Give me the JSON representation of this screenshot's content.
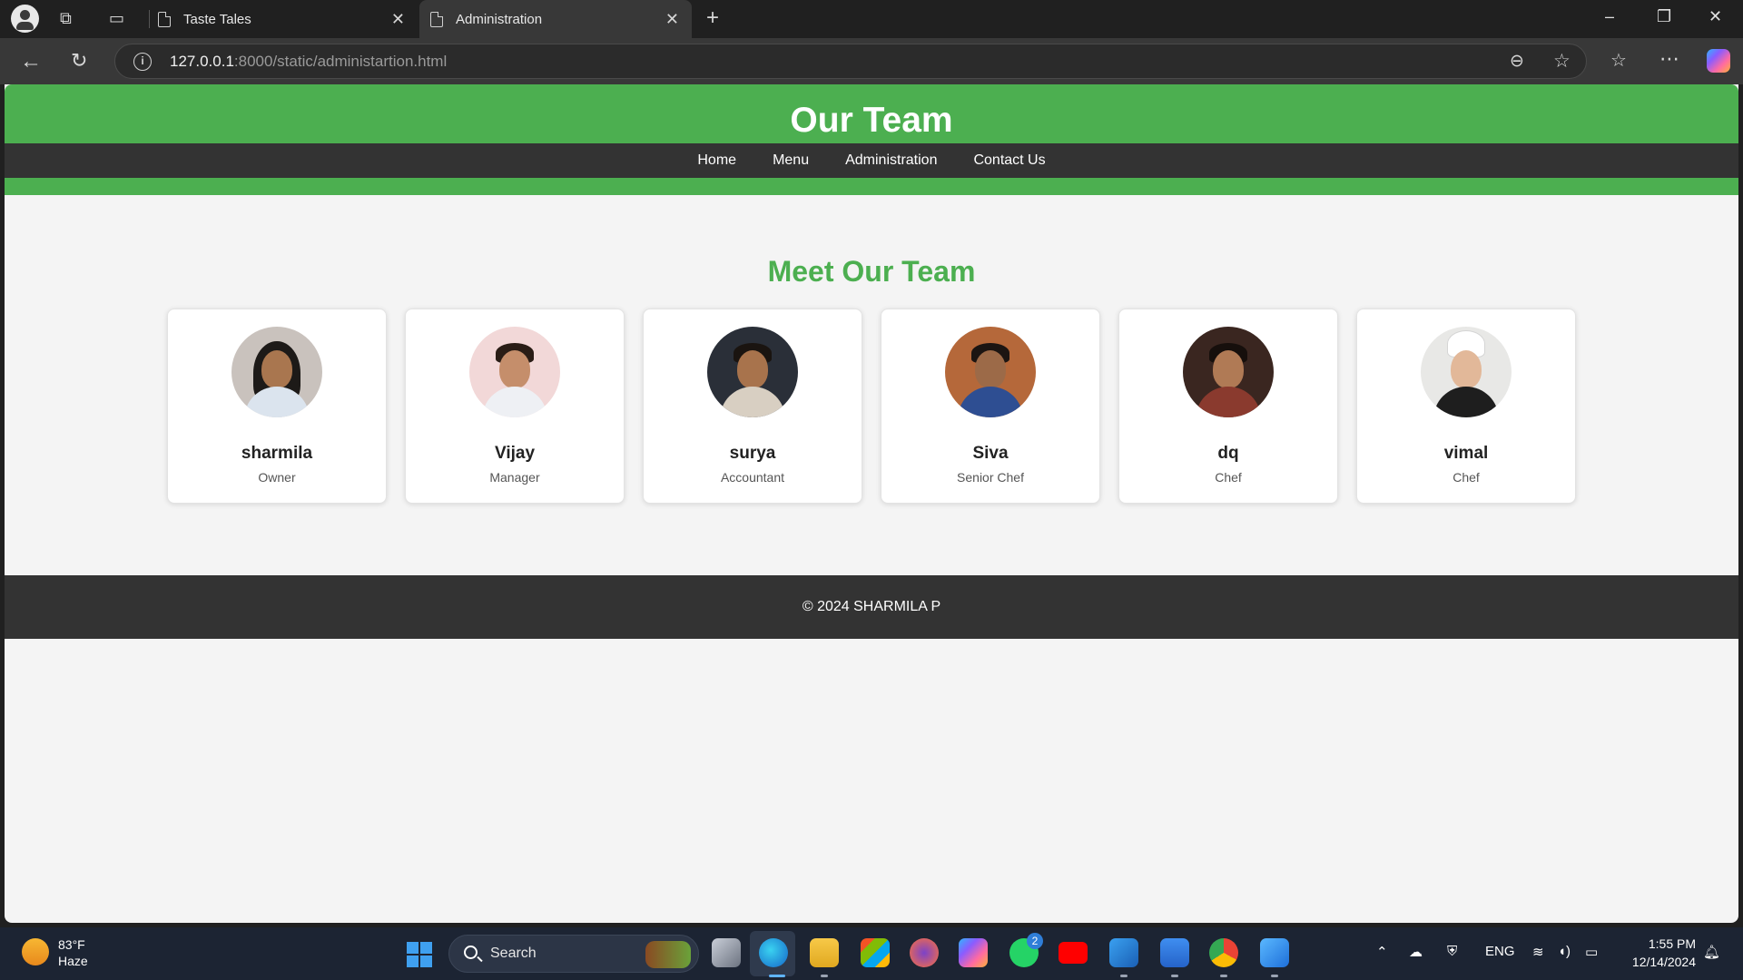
{
  "browser": {
    "tabs": [
      {
        "title": "Taste Tales",
        "active": false
      },
      {
        "title": "Administration",
        "active": true
      }
    ],
    "address": {
      "host": "127.0.0.1",
      "rest": ":8000/static/administartion.html"
    },
    "icons": {
      "tab_actions": "collections-icon",
      "vertical_tabs": "tab-actions-icon",
      "new_tab": "plus-icon",
      "zoom": "zoom-out-icon",
      "favorite": "star-icon",
      "favorites": "favorites-icon",
      "more": "more-icon",
      "copilot": "copilot-icon"
    }
  },
  "site": {
    "title": "Our Team",
    "nav": [
      "Home",
      "Menu",
      "Administration",
      "Contact Us"
    ],
    "colors": {
      "primary": "#4caf50",
      "dark": "#333333"
    }
  },
  "team": {
    "heading": "Meet Our Team",
    "members": [
      {
        "name": "sharmila",
        "role": "Owner"
      },
      {
        "name": "Vijay",
        "role": "Manager"
      },
      {
        "name": "surya",
        "role": "Accountant"
      },
      {
        "name": "Siva",
        "role": "Senior Chef"
      },
      {
        "name": "dq",
        "role": "Chef"
      },
      {
        "name": "vimal",
        "role": "Chef"
      }
    ]
  },
  "footer": {
    "text": "© 2024 SHARMILA P"
  },
  "taskbar": {
    "weather": {
      "temp": "83°F",
      "condition": "Haze"
    },
    "search_label": "Search",
    "whatsapp_badge": "2",
    "language": "ENG",
    "time": "1:55 PM",
    "date": "12/14/2024"
  }
}
